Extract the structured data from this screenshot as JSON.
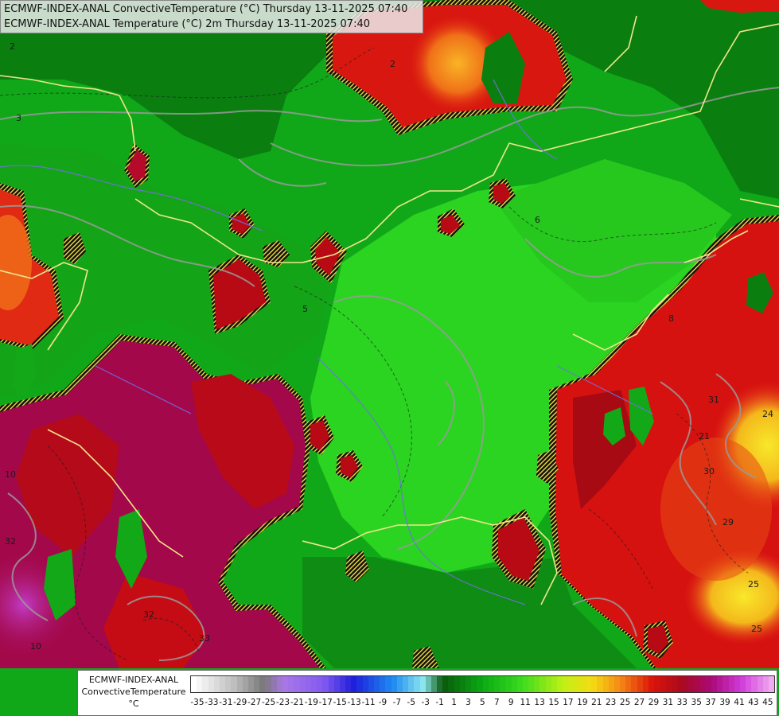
{
  "header": {
    "line1": "ECMWF-INDEX-ANAL ConvectiveTemperature (°C) Thursday 13-11-2025 07:40",
    "line2": "ECMWF-INDEX-ANAL Temperature (°C) 2m Thursday 13-11-2025 07:40"
  },
  "legend": {
    "label_line1": "ECMWF-INDEX-ANAL",
    "label_line2": "ConvectiveTemperature",
    "label_line3": "°C",
    "ticks": [
      "-35",
      "-33",
      "-31",
      "-29",
      "-27",
      "-25",
      "-23",
      "-21",
      "-19",
      "-17",
      "-15",
      "-13",
      "-11",
      "-9",
      "-7",
      "-5",
      "-3",
      "-1",
      "1",
      "3",
      "5",
      "7",
      "9",
      "11",
      "13",
      "15",
      "17",
      "19",
      "21",
      "23",
      "25",
      "27",
      "29",
      "31",
      "33",
      "35",
      "37",
      "39",
      "41",
      "43",
      "45"
    ]
  },
  "contour_labels": [
    "2",
    "3",
    "5",
    "6",
    "8",
    "10",
    "24",
    "21",
    "32",
    "33",
    "25",
    "29",
    "30",
    "31"
  ],
  "colors": {
    "dark_green": "#0a7a10",
    "green": "#12b41a",
    "light_green": "#2ad421",
    "red": "#d41010",
    "dark_red": "#a80a14",
    "crimson": "#a3084a",
    "orange": "#f06a10",
    "yellow": "#f4d21c"
  }
}
